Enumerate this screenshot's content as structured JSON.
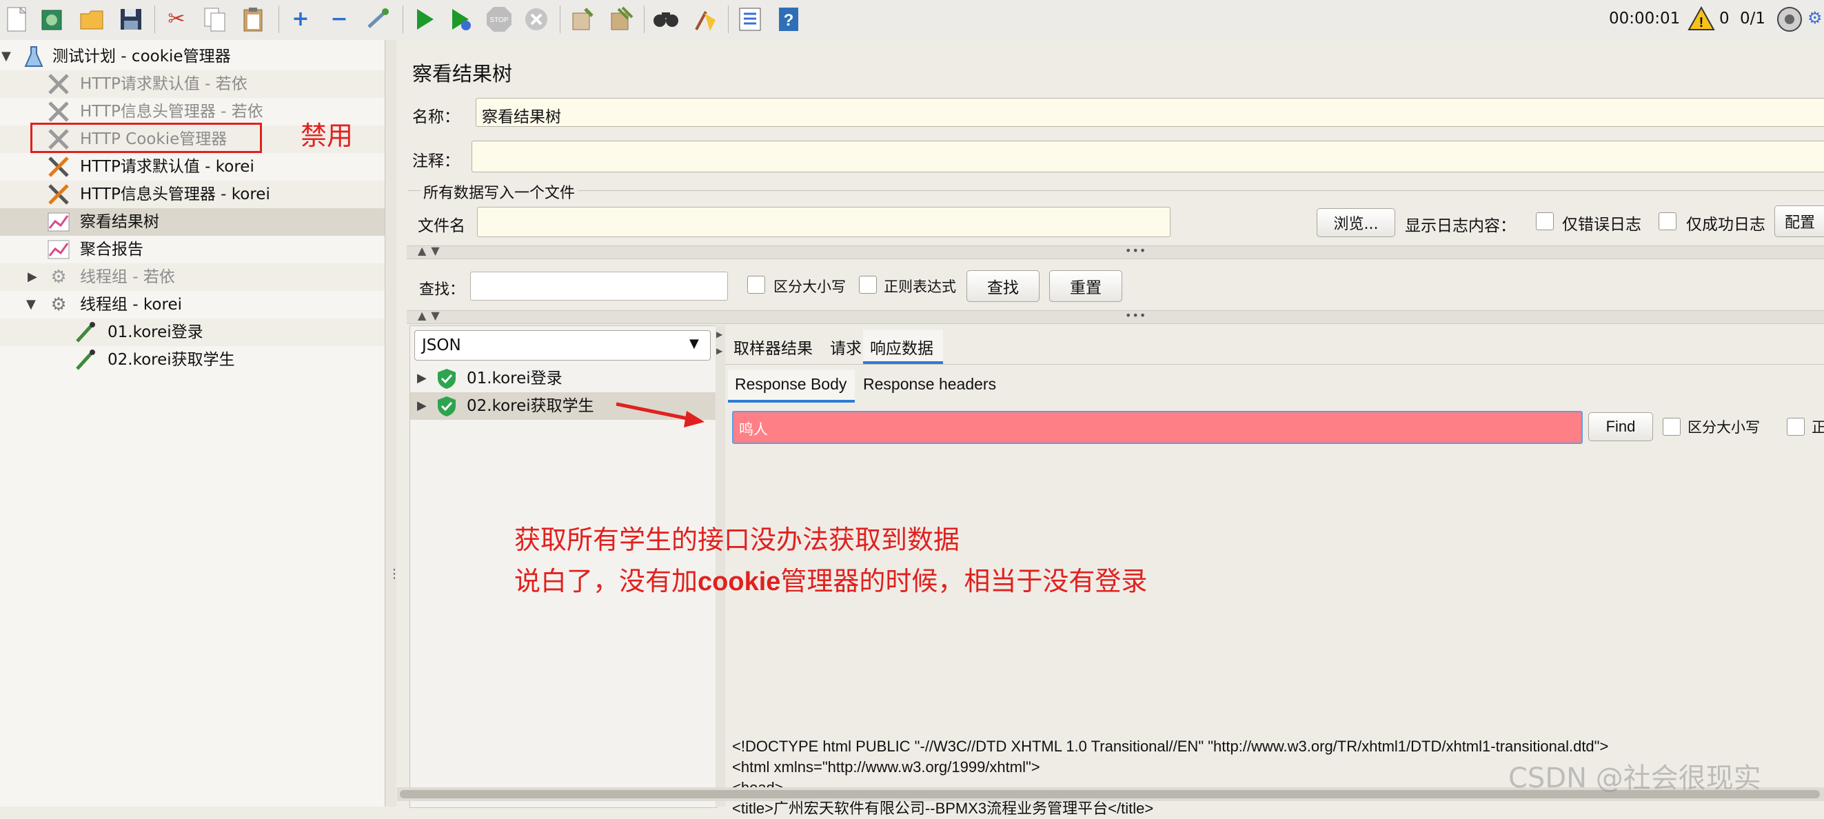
{
  "toolbar": {
    "timer": "00:00:01",
    "warn_count": "0",
    "threads": "0/1"
  },
  "tree": {
    "root": "测试计划 - cookie管理器",
    "items": [
      {
        "label": "HTTP请求默认值 - 若依",
        "disabled": true
      },
      {
        "label": "HTTP信息头管理器 - 若依",
        "disabled": true
      },
      {
        "label": "HTTP Cookie管理器",
        "disabled": true
      },
      {
        "label": "HTTP请求默认值 - korei",
        "disabled": false
      },
      {
        "label": "HTTP信息头管理器 - korei",
        "disabled": false
      },
      {
        "label": "察看结果树",
        "disabled": false
      },
      {
        "label": "聚合报告",
        "disabled": false
      },
      {
        "label": "线程组 - 若依",
        "disabled": true
      },
      {
        "label": "线程组 - korei",
        "disabled": false
      },
      {
        "label": "01.korei登录",
        "disabled": false
      },
      {
        "label": "02.korei获取学生",
        "disabled": false
      }
    ]
  },
  "annotations": {
    "disabled_label": "禁用",
    "line1": "获取所有学生的接口没办法获取到数据",
    "line2_prefix": "说白了，没有加",
    "line2_bold": "cookie",
    "line2_suffix": "管理器的时候，相当于没有登录"
  },
  "panel": {
    "title": "察看结果树",
    "name_label": "名称：",
    "name_value": "察看结果树",
    "comment_label": "注释：",
    "comment_value": "",
    "file_section": "所有数据写入一个文件",
    "filename_label": "文件名",
    "filename_value": "",
    "browse": "浏览...",
    "log_label": "显示日志内容：",
    "errors_only": "仅错误日志",
    "success_only": "仅成功日志",
    "configure": "配置"
  },
  "search": {
    "label": "查找：",
    "value": "",
    "case": "区分大小写",
    "regex": "正则表达式",
    "find": "查找",
    "reset": "重置"
  },
  "results": {
    "renderer": "JSON",
    "samples": [
      "01.korei登录",
      "02.korei获取学生"
    ]
  },
  "tabs": [
    "取样器结果",
    "请求",
    "响应数据"
  ],
  "subtabs": [
    "Response Body",
    "Response headers"
  ],
  "body_search": {
    "value": "鸣人",
    "find": "Find",
    "case": "区分大小写",
    "regex": "正则表"
  },
  "response": {
    "lines": [
      "<!DOCTYPE html PUBLIC \"-//W3C//DTD XHTML 1.0 Transitional//EN\" \"http://www.w3.org/TR/xhtml1/DTD/xhtml1-transitional.dtd\">",
      "<html xmlns=\"http://www.w3.org/1999/xhtml\">",
      "<head>",
      "<title>广州宏天软件有限公司--BPMX3流程业务管理平台</title>"
    ]
  },
  "watermark": "CSDN @社会很现实",
  "colors": {
    "annotation_red": "#e0211f",
    "search_highlight": "#ff7f86",
    "selected_row": "#dcd7cd",
    "field_bg": "#fffbea"
  }
}
